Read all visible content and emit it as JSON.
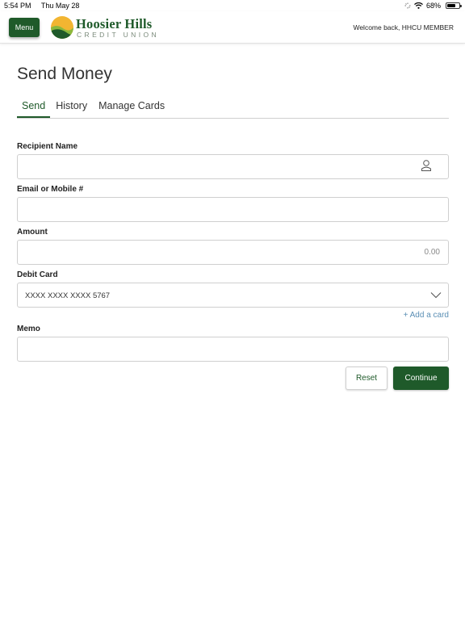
{
  "status_bar": {
    "time": "5:54 PM",
    "date": "Thu May 28",
    "battery": "68%",
    "battery_level": 0.68
  },
  "header": {
    "menu_label": "Menu",
    "logo_line1": "Hoosier Hills",
    "logo_line2": "CREDIT UNION",
    "welcome": "Welcome back, HHCU MEMBER"
  },
  "page": {
    "title": "Send Money",
    "tabs": [
      {
        "label": "Send",
        "active": true
      },
      {
        "label": "History",
        "active": false
      },
      {
        "label": "Manage Cards",
        "active": false
      }
    ]
  },
  "form": {
    "recipient_label": "Recipient Name",
    "recipient_value": "",
    "email_label": "Email or Mobile #",
    "email_value": "",
    "amount_label": "Amount",
    "amount_placeholder": "0.00",
    "debit_label": "Debit Card",
    "debit_value": "XXXX XXXX XXXX 5767",
    "add_card": "+ Add a card",
    "memo_label": "Memo",
    "memo_value": "",
    "reset_label": "Reset",
    "continue_label": "Continue"
  },
  "colors": {
    "brand_green": "#1f5a2a",
    "link_blue": "#5b8fb5"
  }
}
